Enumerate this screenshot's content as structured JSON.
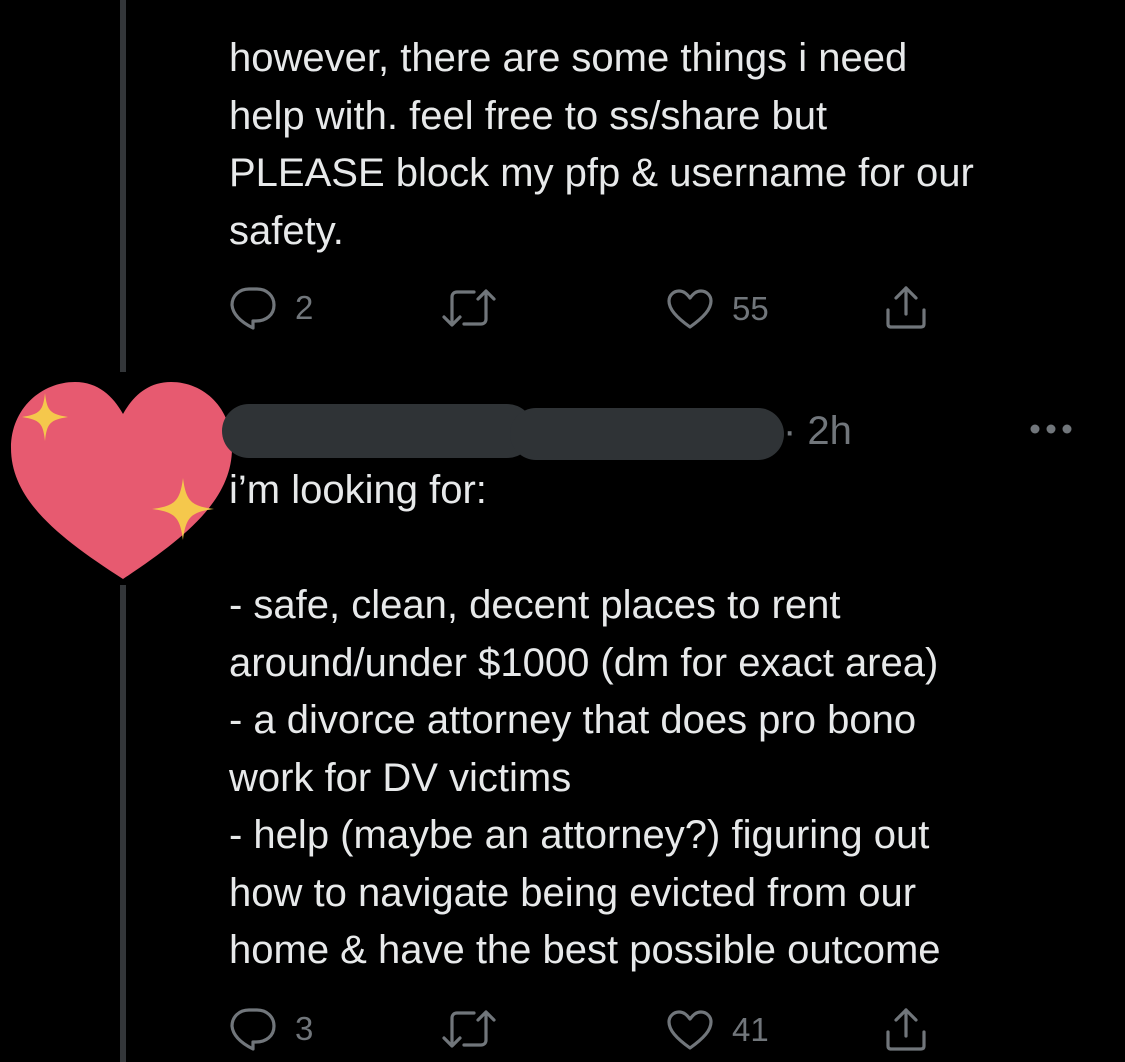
{
  "tweets": [
    {
      "text": "however, there are some things i need\nhelp with. feel free to ss/share but\nPLEASE block my pfp & username for our\nsafety.",
      "actions": {
        "reply_count": "2",
        "like_count": "55"
      }
    },
    {
      "timestamp": "· 2h",
      "text": "i’m looking for:\n\n- safe, clean, decent places to rent\naround/under $1000 (dm for exact area)\n- a divorce attorney that does pro bono\nwork for DV victims\n- help (maybe an attorney?) figuring out\nhow to navigate being evicted from our\nhome & have the best possible outcome",
      "actions": {
        "reply_count": "3",
        "like_count": "41"
      }
    }
  ],
  "icons": {
    "reply": "reply-icon",
    "retweet": "retweet-icon",
    "like": "like-icon",
    "share": "share-icon",
    "more": "more-icon",
    "avatar_sticker": "sparkling-heart-icon"
  },
  "colors": {
    "background": "#000000",
    "text": "#e7e9ea",
    "secondary": "#71767b",
    "thread_line": "#333639",
    "redaction": "#2f3336",
    "heart": "#e75a70",
    "sparkle": "#f5c84c"
  }
}
